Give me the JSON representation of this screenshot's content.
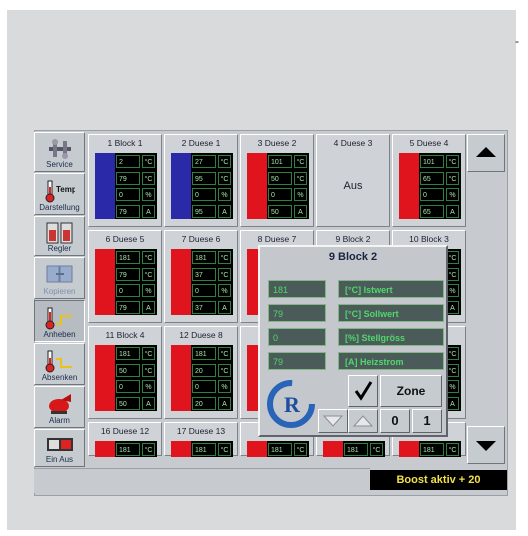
{
  "corner_mark": "-",
  "sidebar": [
    {
      "label": "Service",
      "icon": "tools-icon"
    },
    {
      "label": "Darstellung",
      "icon": "thermometer-temp-icon",
      "icon_text": "Temp"
    },
    {
      "label": "Regler",
      "icon": "controllers-icon",
      "icon_text": "2E1 2E1"
    },
    {
      "label": "Kopieren",
      "icon": "copy-icon"
    },
    {
      "label": "Anheben",
      "icon": "raise-icon"
    },
    {
      "label": "Absenken",
      "icon": "lower-icon"
    },
    {
      "label": "Alarm",
      "icon": "alarm-horn-icon"
    },
    {
      "label": "Ein  Aus",
      "icon": "on-off-icon"
    }
  ],
  "cells": [
    {
      "title": "1  Block 1",
      "values": [
        "2",
        "79",
        "0",
        "79"
      ],
      "bar": "blue"
    },
    {
      "title": "2  Duese 1",
      "values": [
        "27",
        "95",
        "0",
        "95"
      ],
      "bar": "blue"
    },
    {
      "title": "3  Duese 2",
      "values": [
        "101",
        "50",
        "0",
        "50"
      ],
      "bar": "red"
    },
    {
      "title": "4  Duese 3",
      "aus": "Aus"
    },
    {
      "title": "5  Duese 4",
      "values": [
        "101",
        "65",
        "0",
        "65"
      ],
      "bar": "red"
    },
    {
      "title": "6  Duese 5",
      "values": [
        "181",
        "79",
        "0",
        "79"
      ],
      "bar": "red"
    },
    {
      "title": "7  Duese 6",
      "values": [
        "181",
        "37",
        "0",
        "37"
      ],
      "bar": "red"
    },
    {
      "title": "8  Duese 7",
      "values": [
        "",
        "",
        "",
        ""
      ],
      "bar": "red"
    },
    {
      "title": "9  Block 2",
      "values": [
        "",
        "",
        "",
        ""
      ],
      "bar": "red"
    },
    {
      "title": "10  Block 3",
      "values": [
        "",
        "",
        "",
        ""
      ],
      "bar": "red"
    },
    {
      "title": "11  Block 4",
      "values": [
        "181",
        "50",
        "0",
        "50"
      ],
      "bar": "red"
    },
    {
      "title": "12  Duese 8",
      "values": [
        "181",
        "20",
        "0",
        "20"
      ],
      "bar": "red"
    },
    {
      "title": "13",
      "values": [
        "",
        "",
        "",
        ""
      ],
      "bar": "red"
    },
    {
      "title": "",
      "values": [
        "",
        "",
        "",
        ""
      ],
      "bar": "red"
    },
    {
      "title": "11",
      "values": [
        "",
        "",
        "",
        ""
      ],
      "bar": "red"
    },
    {
      "title": "16  Duese 12",
      "values": [
        "181"
      ],
      "bar": "red"
    },
    {
      "title": "17  Duese 13",
      "values": [
        "181"
      ],
      "bar": "red"
    },
    {
      "title": "18",
      "values": [
        "181"
      ],
      "bar": "red"
    },
    {
      "title": "",
      "values": [
        "181"
      ],
      "bar": "red"
    },
    {
      "title": "16",
      "values": [
        "181"
      ],
      "bar": "red"
    }
  ],
  "units": [
    "°C",
    "°C",
    "%",
    "A"
  ],
  "popup": {
    "title": "9  Block  2",
    "rows": [
      {
        "value": "181",
        "label": "[°C]  Istwert"
      },
      {
        "value": "79",
        "label": "[°C]  Sollwert"
      },
      {
        "value": "0",
        "label": "[%]  Stellgröss"
      },
      {
        "value": "79",
        "label": "[A]  Heizstrom"
      }
    ],
    "logo_letters": "R",
    "zone_label": "Zone",
    "zone_0": "0",
    "zone_1": "1"
  },
  "status": "Boost aktiv + 20",
  "colors": {
    "red": "#e0141c",
    "blue": "#2a2aa8",
    "black": "#000000"
  }
}
